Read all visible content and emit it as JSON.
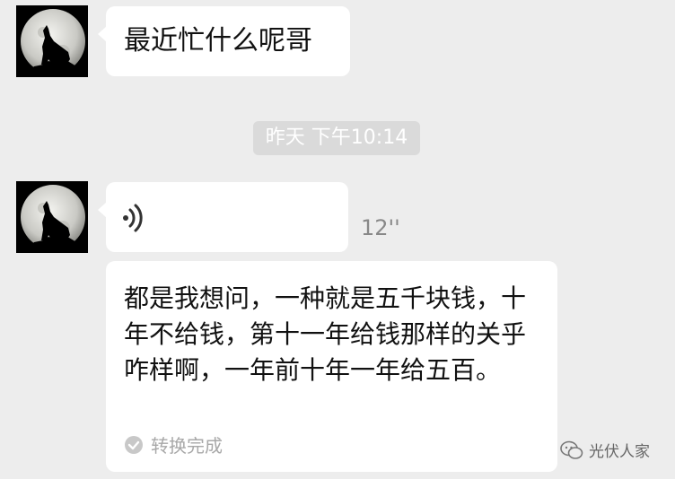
{
  "messages": [
    {
      "text": "最近忙什么呢哥"
    }
  ],
  "timestamp": "昨天 下午10:14",
  "voice_message": {
    "duration": "12''",
    "transcript": "都是我想问，一种就是五千块钱，十年不给钱，第十一年给钱那样的关乎咋样啊，一年前十年一年给五百。",
    "status": "转换完成"
  },
  "watermark": "光伏人家",
  "icons": {
    "avatar": "wolf-howling-moon-avatar",
    "voice": "voice-wave-icon",
    "status": "check-circle-icon",
    "watermark": "wechat-logo-icon"
  },
  "colors": {
    "background": "#ededed",
    "bubble": "#ffffff",
    "timestamp_bg": "#dadada",
    "muted": "#a8a8a8"
  }
}
